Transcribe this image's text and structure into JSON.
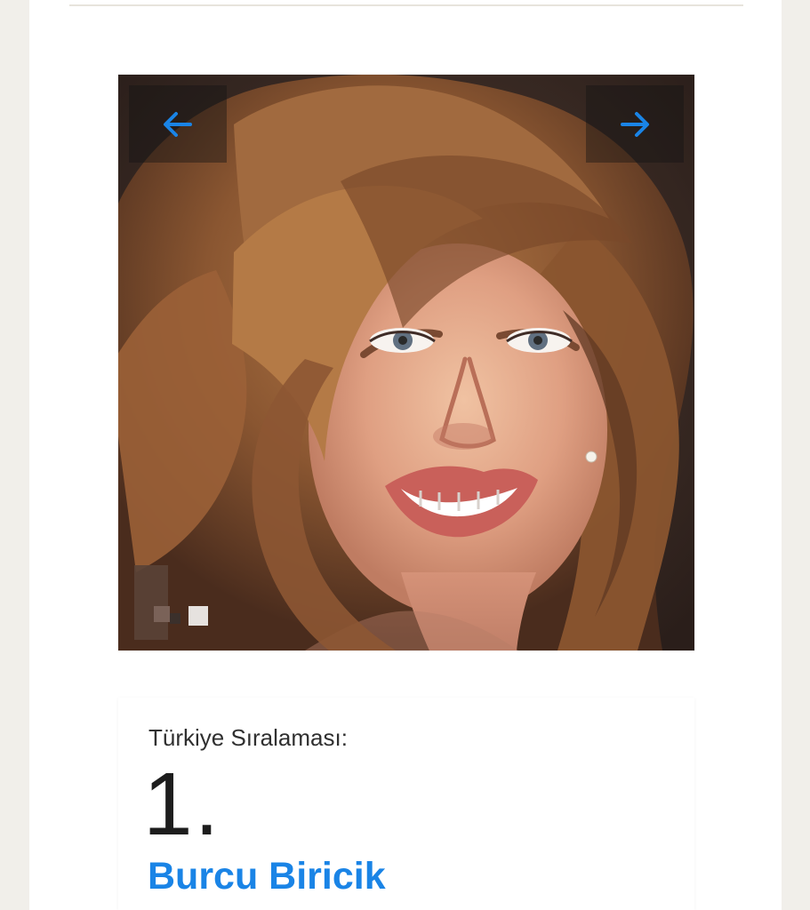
{
  "gallery": {
    "image_alt": "Burcu Biricik",
    "previous_label": "Previous",
    "next_label": "Next"
  },
  "ranking": {
    "label": "Türkiye Sıralaması:",
    "value": "1."
  },
  "person": {
    "name": "Burcu Biricik"
  },
  "colors": {
    "accent": "#1a84e6",
    "page_background": "#f1efea",
    "card_background": "#ffffff",
    "arrow_overlay": "#141414"
  },
  "icons": {
    "previous": "arrow-left-icon",
    "next": "arrow-right-icon"
  }
}
